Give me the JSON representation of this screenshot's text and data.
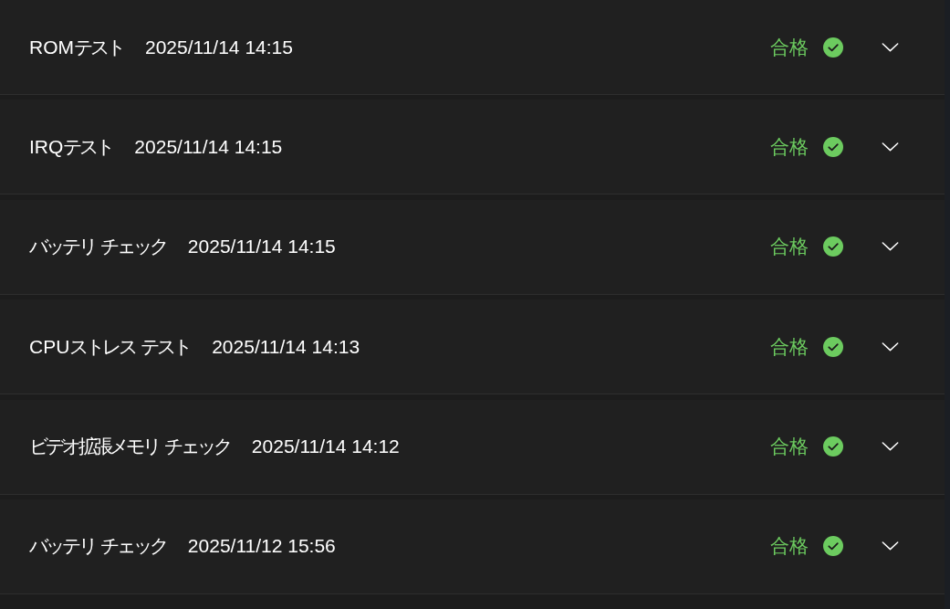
{
  "results": [
    {
      "name": "ROMテスト",
      "timestamp": "2025/11/14 14:15",
      "status": "合格",
      "kind": "pass",
      "expanded": false
    },
    {
      "name": "IRQテスト",
      "timestamp": "2025/11/14 14:15",
      "status": "合格",
      "kind": "pass",
      "expanded": false
    },
    {
      "name": "バッテリ チェック",
      "timestamp": "2025/11/14 14:15",
      "status": "合格",
      "kind": "pass",
      "expanded": false
    },
    {
      "name": "CPUストレス テスト",
      "timestamp": "2025/11/14 14:13",
      "status": "合格",
      "kind": "pass",
      "expanded": false
    },
    {
      "name": "ビデオ拡張メモリ チェック",
      "timestamp": "2025/11/14 14:12",
      "status": "合格",
      "kind": "pass",
      "expanded": false
    },
    {
      "name": "バッテリ チェック",
      "timestamp": "2025/11/12 15:56",
      "status": "合格",
      "kind": "pass",
      "expanded": false
    }
  ]
}
